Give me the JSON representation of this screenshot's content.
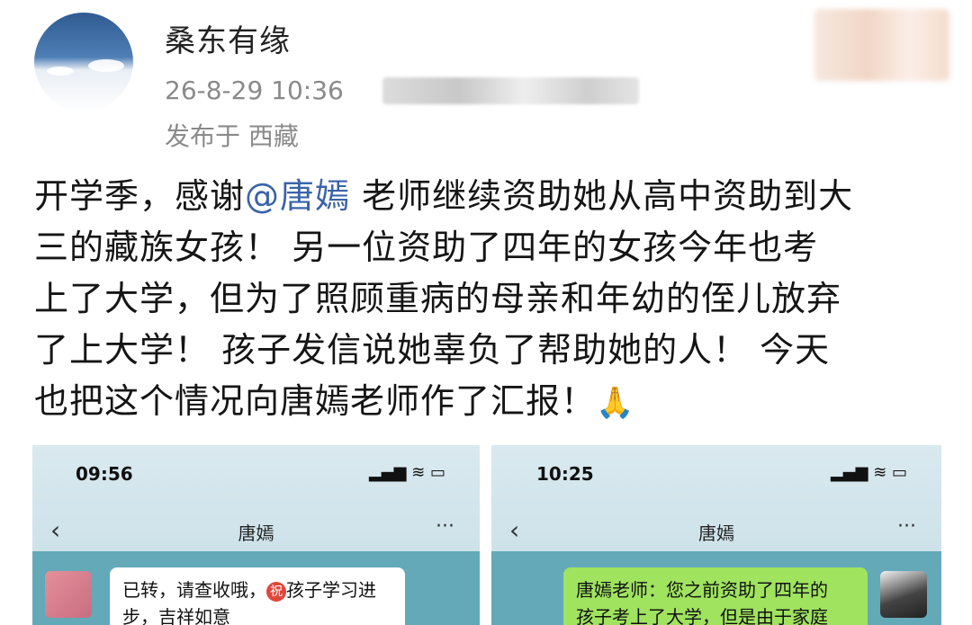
{
  "post": {
    "username": "桑东有缘",
    "timestamp": "26-8-29 10:36",
    "location": "发布于 西藏",
    "body_lines": [
      {
        "pre": "开学季，感谢",
        "mention": "@唐嫣",
        "post": " 老师继续资助她从高中资助到大"
      },
      {
        "text": "三的藏族女孩！ 另一位资助了四年的女孩今年也考"
      },
      {
        "text": "上了大学，但为了照顾重病的母亲和年幼的侄儿放弃"
      },
      {
        "text": "了上大学！ 孩子发信说她辜负了帮助她的人！ 今天"
      },
      {
        "text": "也把这个情况向唐嫣老师作了汇报！",
        "emoji": "🙏"
      }
    ]
  },
  "screenshots": [
    {
      "status_time": "09:56",
      "status_icons": "▂▄▆ ≋ ▭",
      "chat_title": "唐嫣",
      "back_glyph": "‹",
      "more_glyph": "···",
      "bubble_text_a": "已转，请查收哦，",
      "badge": "祝",
      "bubble_text_b": "孩子学习进",
      "bubble_text_c": "步，吉祥如意"
    },
    {
      "status_time": "10:25",
      "status_icons": "▂▄▆ ≋ ▭",
      "chat_title": "唐嫣",
      "back_glyph": "‹",
      "more_glyph": "···",
      "bubble_line1": "唐嫣老师：您之前资助了四年的",
      "bubble_line2": "孩子考上了大学，但是由于家庭"
    }
  ],
  "colors": {
    "mention": "#3a63a8",
    "chat_bg": "#63a9b8",
    "bubble_green": "#9fe35e"
  }
}
